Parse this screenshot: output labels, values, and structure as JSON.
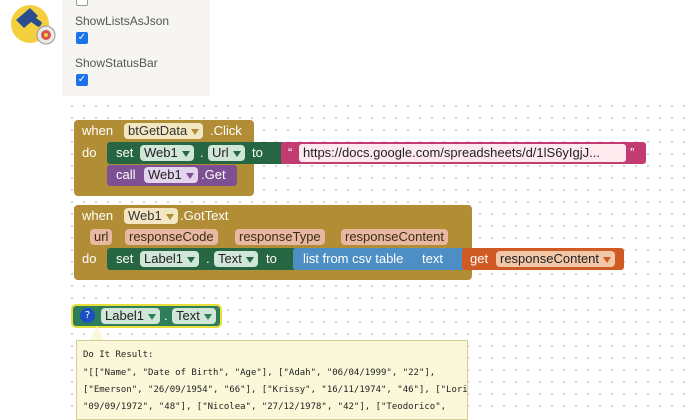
{
  "properties": [
    {
      "label": "ShowListsAsJson",
      "checked": true
    },
    {
      "label": "ShowStatusBar",
      "checked": true
    }
  ],
  "event1": {
    "when": "when",
    "component": "btGetData",
    "event": ".Click",
    "do": "do",
    "set": "set",
    "set_component": "Web1",
    "dot": ".",
    "set_property": "Url",
    "to": "to",
    "url_value": "https://docs.google.com/spreadsheets/d/1lS6yIgjJ...",
    "quote_open": "“",
    "quote_close": "”",
    "call": "call",
    "call_component": "Web1",
    "call_method": ".Get"
  },
  "event2": {
    "when": "when",
    "component": "Web1",
    "event": ".GotText",
    "params": [
      "url",
      "responseCode",
      "responseType",
      "responseContent"
    ],
    "do": "do",
    "set": "set",
    "set_component": "Label1",
    "dot": ".",
    "set_property": "Text",
    "to": "to",
    "csv_block": "list from csv table",
    "csv_text": "text",
    "get": "get",
    "get_var": "responseContent"
  },
  "getter": {
    "help_icon": "?",
    "component": "Label1",
    "dot": ".",
    "property": "Text"
  },
  "result": {
    "header": "Do It Result:",
    "lines": [
      "\"[[\"Name\", \"Date of Birth\", \"Age\"], [\"Adah\", \"06/04/1999\", \"22\"],",
      "[\"Emerson\", \"26/09/1954\", \"66\"], [\"Krissy\", \"16/11/1974\", \"46\"], [\"Lorin\",",
      "\"09/09/1972\", \"48\"], [\"Nicolea\", \"27/12/1978\", \"42\"], [\"Teodorico\","
    ]
  }
}
